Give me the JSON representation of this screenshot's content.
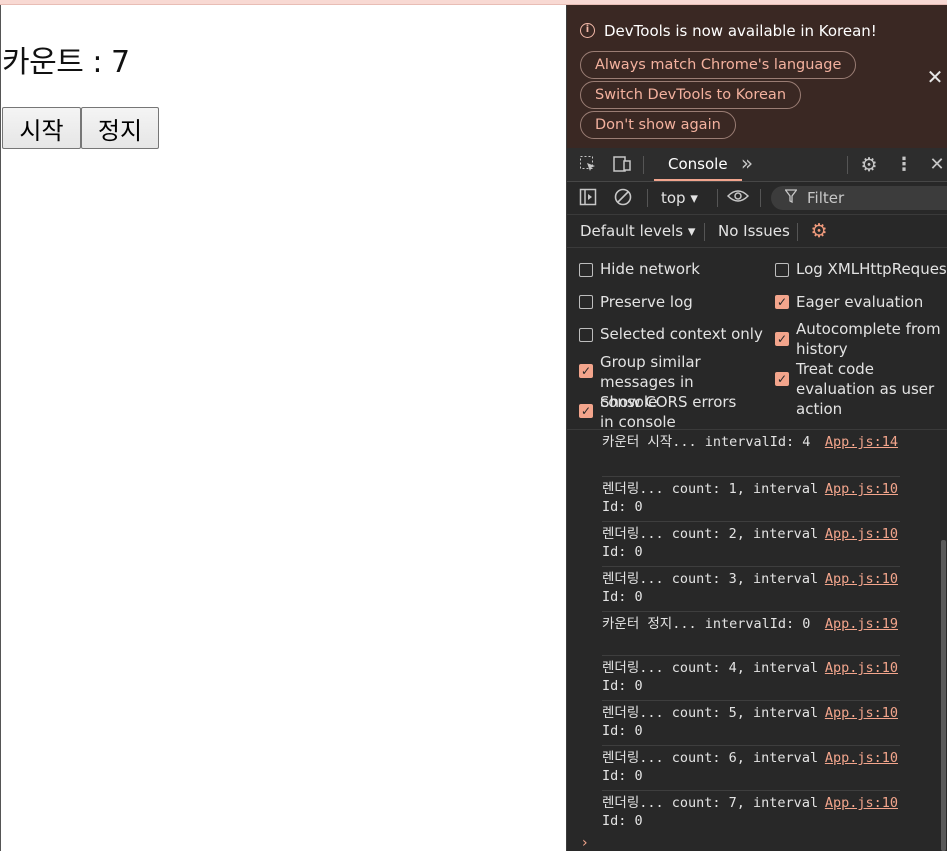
{
  "page": {
    "count_text": "카운트 : 7",
    "start_button": "시작",
    "stop_button": "정지"
  },
  "devtools": {
    "notice": {
      "message": "DevTools is now available in Korean!",
      "btn_always": "Always match Chrome's language",
      "btn_switch": "Switch DevTools to Korean",
      "btn_dont": "Don't show again",
      "close": "✕"
    },
    "tabs": {
      "console": "Console",
      "more": "»"
    },
    "toolbar": {
      "context": "top ▾",
      "filter_placeholder": "Filter"
    },
    "levelbar": {
      "levels": "Default levels ▾",
      "issues": "No Issues"
    },
    "settings": {
      "hide_network": "Hide network",
      "preserve_log": "Preserve log",
      "selected_context": "Selected context only",
      "group_similar": "Group similar messages in console",
      "show_cors": "Show CORS errors in console",
      "log_xhr": "Log XMLHttpRequests",
      "eager_eval": "Eager evaluation",
      "autocomplete": "Autocomplete from history",
      "treat_code": "Treat code evaluation as user action"
    },
    "logs": [
      {
        "msg": "카운터 시작... intervalId: 4",
        "src": "App.js:14"
      },
      {
        "msg": "렌더링... count: 1, intervalId: 0",
        "src": "App.js:10"
      },
      {
        "msg": "렌더링... count: 2, intervalId: 0",
        "src": "App.js:10"
      },
      {
        "msg": "렌더링... count: 3, intervalId: 0",
        "src": "App.js:10"
      },
      {
        "msg": "카운터 정지... intervalId: 0",
        "src": "App.js:19"
      },
      {
        "msg": "렌더링... count: 4, intervalId: 0",
        "src": "App.js:10"
      },
      {
        "msg": "렌더링... count: 5, intervalId: 0",
        "src": "App.js:10"
      },
      {
        "msg": "렌더링... count: 6, intervalId: 0",
        "src": "App.js:10"
      },
      {
        "msg": "렌더링... count: 7, intervalId: 0",
        "src": "App.js:10"
      }
    ],
    "prompt": "›"
  }
}
